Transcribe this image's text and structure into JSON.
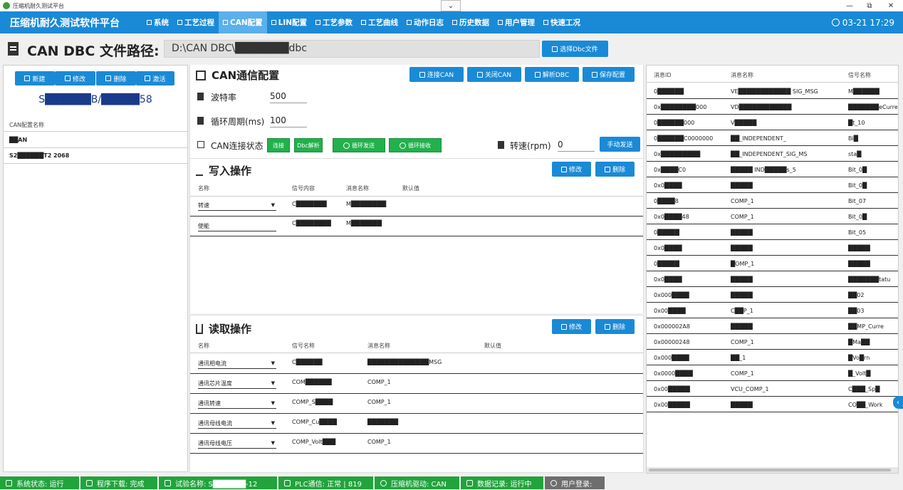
{
  "window": {
    "title": "压缩机耐久测试平台",
    "dropdown": "⌄",
    "minimize": "—",
    "restore": "⧉",
    "close": "✕"
  },
  "nav": {
    "brand": "压缩机耐久测试软件平台",
    "items": [
      "系统",
      "工艺过程",
      "CAN配置",
      "LIN配置",
      "工艺参数",
      "工艺曲线",
      "动作日志",
      "历史数据",
      "用户管理",
      "快速工况"
    ],
    "active_index": 2,
    "clock": "03-21 17:29"
  },
  "path": {
    "label": "CAN DBC 文件路径:",
    "value": "D:\\CAN DBC\\███████dbc",
    "choose_button": "选择Dbc文件"
  },
  "left": {
    "buttons": [
      "新建",
      "修改",
      "删除",
      "激活"
    ],
    "serial": "S██████B/█████58",
    "list_header": "CAN配置名称",
    "list_items": [
      "██AN",
      "S2██████T2 2068"
    ]
  },
  "can": {
    "title": "CAN通信配置",
    "buttons": [
      "连接CAN",
      "关闭CAN",
      "解析DBC",
      "保存配置"
    ],
    "baud_label": "波特率",
    "baud_value": "500",
    "cycle_label": "循环周期(ms)",
    "cycle_value": "100",
    "status_label": "CAN连接状态",
    "status_connect": "连接",
    "status_parse": "Dbc解析",
    "loop_send": "循环发送",
    "loop_recv": "循环接收",
    "speed_label": "转速(rpm)",
    "speed_value": "0",
    "manual_send": "手动发送"
  },
  "write": {
    "title": "写入操作",
    "edit": "修改",
    "delete": "删除",
    "columns": [
      "名称",
      "信号内容",
      "消息名称",
      "默认值"
    ],
    "rows": [
      {
        "name": "转速",
        "signal": "C███████",
        "message": "M████████"
      },
      {
        "name": "使能",
        "signal": "C████████",
        "message": "M███████"
      }
    ]
  },
  "read": {
    "title": "读取操作",
    "edit": "修改",
    "delete": "删除",
    "columns": [
      "名称",
      "信号名称",
      "消息名称",
      "默认值"
    ],
    "rows": [
      {
        "name": "通讯相电流",
        "signal": "C██████",
        "message": "██████████████MSG"
      },
      {
        "name": "通讯芯片温度",
        "signal": "COM██████",
        "message": "COMP_1"
      },
      {
        "name": "通讯转速",
        "signal": "COMP_S████",
        "message": "COMP_1"
      },
      {
        "name": "通讯母线电流",
        "signal": "COMP_Cu████",
        "message": "███████"
      },
      {
        "name": "通讯母线电压",
        "signal": "COMP_Volt███",
        "message": "COMP_1"
      }
    ]
  },
  "msgtable": {
    "columns": [
      "消息ID",
      "消息名称",
      "信号名称"
    ],
    "rows": [
      {
        "id": "0██████",
        "name": "VE████████████ SIG_MSG",
        "signal": "M██████"
      },
      {
        "id": "0x████████000",
        "name": "VD████████████",
        "signal": "███████eCurre"
      },
      {
        "id": "0██████000",
        "name": "V█████",
        "signal": "█t_10"
      },
      {
        "id": "0██████C0000000",
        "name": "██_INDEPENDENT_",
        "signal": "Bi█"
      },
      {
        "id": "0x█████████",
        "name": "██_INDEPENDENT_SIG_MS",
        "signal": "sta█"
      },
      {
        "id": "0x████C0",
        "name": "█████ IND█████s_5",
        "signal": "Bit_0█"
      },
      {
        "id": "0x0████",
        "name": "█████",
        "signal": "Bit_0█"
      },
      {
        "id": "0████8",
        "name": "COMP_1",
        "signal": "Bit_07"
      },
      {
        "id": "0x0████48",
        "name": "COMP_1",
        "signal": "Bit_0█"
      },
      {
        "id": "0█████",
        "name": "█████",
        "signal": "Bit_05"
      },
      {
        "id": "0x0████",
        "name": "█████",
        "signal": "█████"
      },
      {
        "id": "0█████",
        "name": "█OMP_1",
        "signal": "█████"
      },
      {
        "id": "0x0████",
        "name": "█████",
        "signal": "███████tatu"
      },
      {
        "id": "0x000████",
        "name": "█████",
        "signal": "██02"
      },
      {
        "id": "0x00████",
        "name": "C██P_1",
        "signal": "██03"
      },
      {
        "id": "0x000002A8",
        "name": "█████",
        "signal": "██MP_Curre"
      },
      {
        "id": "0x00000248",
        "name": "COMP_1",
        "signal": "█Ma██"
      },
      {
        "id": "0x000████",
        "name": "██_1",
        "signal": "█Vo█rn"
      },
      {
        "id": "0x0000████",
        "name": "COMP_1",
        "signal": "█_Volt█"
      },
      {
        "id": "0x00█████",
        "name": "VCU_COMP_1",
        "signal": "C███_Sp█"
      },
      {
        "id": "0x00█████",
        "name": "█████",
        "signal": "CO██_Work"
      }
    ]
  },
  "status": [
    {
      "label": "系统状态: 运行",
      "gray": false
    },
    {
      "label": "程序下载: 完成",
      "gray": false
    },
    {
      "label": "试验名称: S██████-12",
      "gray": false
    },
    {
      "label": "PLC通信: 正常 | 819",
      "gray": false
    },
    {
      "label": "压缩机驱动: CAN",
      "gray": false
    },
    {
      "label": "数据记录: 运行中",
      "gray": false
    },
    {
      "label": "用户登录:",
      "gray": true
    }
  ]
}
